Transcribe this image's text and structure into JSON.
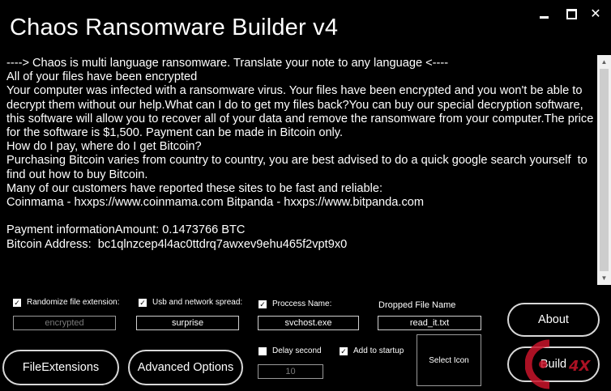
{
  "window": {
    "title": "Chaos Ransomware Builder v4",
    "minimize_glyph": "minimize-icon",
    "maximize_glyph": "maximize-icon",
    "close_glyph": "✕"
  },
  "note": {
    "text": "----> Chaos is multi language ransomware. Translate your note to any language <----\nAll of your files have been encrypted\nYour computer was infected with a ransomware virus. Your files have been encrypted and you won't be able to decrypt them without our help.What can I do to get my files back?You can buy our special decryption software, this software will allow you to recover all of your data and remove the ransomware from your computer.The price for the software is $1,500. Payment can be made in Bitcoin only.\nHow do I pay, where do I get Bitcoin?\nPurchasing Bitcoin varies from country to country, you are best advised to do a quick google search yourself  to find out how to buy Bitcoin.\nMany of our customers have reported these sites to be fast and reliable:\nCoinmama - hxxps://www.coinmama.com Bitpanda - hxxps://www.bitpanda.com\n\nPayment informationAmount: 0.1473766 BTC\nBitcoin Address:  bc1qlnzcep4l4ac0ttdrq7awxev9ehu465f2vpt9x0"
  },
  "options": {
    "randomize_ext": {
      "label": "Randomize file extension:",
      "checked": true,
      "value": "encrypted"
    },
    "usb_spread": {
      "label": "Usb and network spread:",
      "checked": true,
      "value": "surprise"
    },
    "process_name": {
      "label": "Proccess Name:",
      "checked": true,
      "value": "svchost.exe"
    },
    "dropped_file": {
      "label": "Dropped File Name",
      "value": "read_it.txt"
    },
    "delay_second": {
      "label": "Delay second",
      "checked": false,
      "value": "10"
    },
    "add_startup": {
      "label": "Add to startup",
      "checked": true
    }
  },
  "buttons": {
    "file_extensions": "FileExtensions",
    "advanced_options": "Advanced Options",
    "select_icon": "Select Icon",
    "about": "About",
    "build": "Build"
  },
  "colors": {
    "background": "#000000",
    "text": "#ffffff",
    "watermark_red": "#c8142a"
  }
}
